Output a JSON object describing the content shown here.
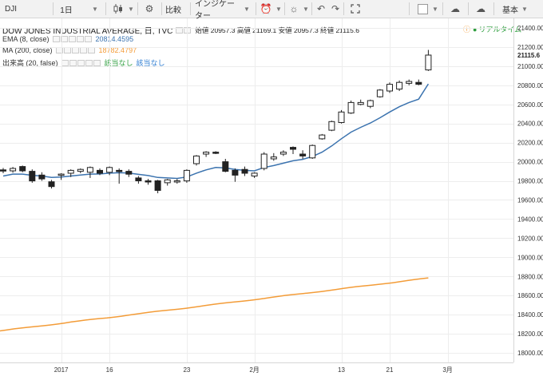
{
  "toolbar": {
    "symbol": "DJI",
    "interval": "1日",
    "compare_label": "比較",
    "indicators_label": "インジケーター",
    "layout_label": "基本"
  },
  "legend": {
    "title": "DOW JONES INDUSTRIAL AVERAGE, 日, TVC",
    "ohlc": "始値 20957.3 高値 21169.1 安値 20957.3 終値 21115.6",
    "realtime": "リアルタイム",
    "ema_label": "EMA (8, close)",
    "ema_value": "20814.4595",
    "ma_label": "MA (200, close)",
    "ma_value": "18782.4797",
    "vol_label": "出来高 (20, false)",
    "vol_value1": "該当なし",
    "vol_value2": "該当なし"
  },
  "colors": {
    "ema": "#3b73af",
    "ma": "#f39c38",
    "realtime": "#2e9e3e",
    "vol1": "#2e9e3e",
    "vol2": "#2b7bd1"
  },
  "chart_data": {
    "type": "candlestick",
    "ylim": [
      17900,
      21500
    ],
    "price_ticks": [
      "21400.00",
      "21200.00",
      "21000.00",
      "20800.00",
      "20600.00",
      "20400.00",
      "20200.00",
      "20000.00",
      "19800.00",
      "19600.00",
      "19400.00",
      "19200.00",
      "19000.00",
      "18800.00",
      "18600.00",
      "18400.00",
      "18200.00",
      "18000.00"
    ],
    "last_price": "21115.6",
    "time_labels": [
      "2017",
      "16",
      "23",
      "2月",
      "13",
      "21",
      "3月"
    ],
    "time_label_index": [
      6,
      11,
      19,
      26,
      35,
      40,
      46
    ],
    "candles": [
      {
        "o": 19915,
        "h": 19935,
        "l": 19880,
        "c": 19905
      },
      {
        "o": 19905,
        "h": 19945,
        "l": 19885,
        "c": 19930
      },
      {
        "o": 19950,
        "h": 19960,
        "l": 19890,
        "c": 19905
      },
      {
        "o": 19900,
        "h": 19920,
        "l": 19780,
        "c": 19800
      },
      {
        "o": 19860,
        "h": 19890,
        "l": 19800,
        "c": 19820
      },
      {
        "o": 19790,
        "h": 19810,
        "l": 19720,
        "c": 19740
      },
      {
        "o": 19860,
        "h": 19880,
        "l": 19810,
        "c": 19870
      },
      {
        "o": 19880,
        "h": 19920,
        "l": 19840,
        "c": 19910
      },
      {
        "o": 19900,
        "h": 19930,
        "l": 19880,
        "c": 19920
      },
      {
        "o": 19890,
        "h": 19950,
        "l": 19830,
        "c": 19940
      },
      {
        "o": 19910,
        "h": 19930,
        "l": 19860,
        "c": 19880
      },
      {
        "o": 19890,
        "h": 19950,
        "l": 19860,
        "c": 19940
      },
      {
        "o": 19910,
        "h": 19930,
        "l": 19770,
        "c": 19900
      },
      {
        "o": 19900,
        "h": 19920,
        "l": 19840,
        "c": 19870
      },
      {
        "o": 19830,
        "h": 19850,
        "l": 19770,
        "c": 19800
      },
      {
        "o": 19800,
        "h": 19820,
        "l": 19760,
        "c": 19790
      },
      {
        "o": 19800,
        "h": 19810,
        "l": 19670,
        "c": 19700
      },
      {
        "o": 19780,
        "h": 19820,
        "l": 19750,
        "c": 19810
      },
      {
        "o": 19790,
        "h": 19820,
        "l": 19770,
        "c": 19800
      },
      {
        "o": 19800,
        "h": 19920,
        "l": 19780,
        "c": 19910
      },
      {
        "o": 19980,
        "h": 20070,
        "l": 19960,
        "c": 20060
      },
      {
        "o": 20080,
        "h": 20110,
        "l": 20050,
        "c": 20100
      },
      {
        "o": 20100,
        "h": 20110,
        "l": 20080,
        "c": 20090
      },
      {
        "o": 20000,
        "h": 20030,
        "l": 19890,
        "c": 19900
      },
      {
        "o": 19910,
        "h": 19930,
        "l": 19790,
        "c": 19860
      },
      {
        "o": 19920,
        "h": 19950,
        "l": 19850,
        "c": 19880
      },
      {
        "o": 19850,
        "h": 19890,
        "l": 19830,
        "c": 19880
      },
      {
        "o": 19930,
        "h": 20100,
        "l": 19910,
        "c": 20080
      },
      {
        "o": 20030,
        "h": 20090,
        "l": 20010,
        "c": 20050
      },
      {
        "o": 20080,
        "h": 20120,
        "l": 20060,
        "c": 20100
      },
      {
        "o": 20150,
        "h": 20160,
        "l": 20080,
        "c": 20130
      },
      {
        "o": 20080,
        "h": 20120,
        "l": 20030,
        "c": 20060
      },
      {
        "o": 20040,
        "h": 20180,
        "l": 20030,
        "c": 20170
      },
      {
        "o": 20240,
        "h": 20290,
        "l": 20230,
        "c": 20280
      },
      {
        "o": 20330,
        "h": 20430,
        "l": 20320,
        "c": 20420
      },
      {
        "o": 20410,
        "h": 20540,
        "l": 20400,
        "c": 20520
      },
      {
        "o": 20510,
        "h": 20640,
        "l": 20500,
        "c": 20620
      },
      {
        "o": 20600,
        "h": 20650,
        "l": 20590,
        "c": 20620
      },
      {
        "o": 20580,
        "h": 20650,
        "l": 20560,
        "c": 20640
      },
      {
        "o": 20680,
        "h": 20760,
        "l": 20670,
        "c": 20750
      },
      {
        "o": 20740,
        "h": 20830,
        "l": 20720,
        "c": 20810
      },
      {
        "o": 20760,
        "h": 20850,
        "l": 20740,
        "c": 20830
      },
      {
        "o": 20820,
        "h": 20860,
        "l": 20800,
        "c": 20840
      },
      {
        "o": 20830,
        "h": 20860,
        "l": 20800,
        "c": 20810
      },
      {
        "o": 20960,
        "h": 21170,
        "l": 20950,
        "c": 21115.6
      }
    ],
    "ema": [
      19850,
      19870,
      19870,
      19858,
      19850,
      19835,
      19840,
      19850,
      19860,
      19870,
      19872,
      19880,
      19885,
      19882,
      19868,
      19855,
      19835,
      19830,
      19825,
      19840,
      19880,
      19915,
      19940,
      19935,
      19920,
      19910,
      19905,
      19940,
      19960,
      19985,
      20010,
      20025,
      20055,
      20100,
      20165,
      20240,
      20310,
      20360,
      20405,
      20460,
      20520,
      20575,
      20620,
      20655,
      20814.46
    ],
    "ma_start": 18230,
    "ma_end": 18782.4797
  }
}
